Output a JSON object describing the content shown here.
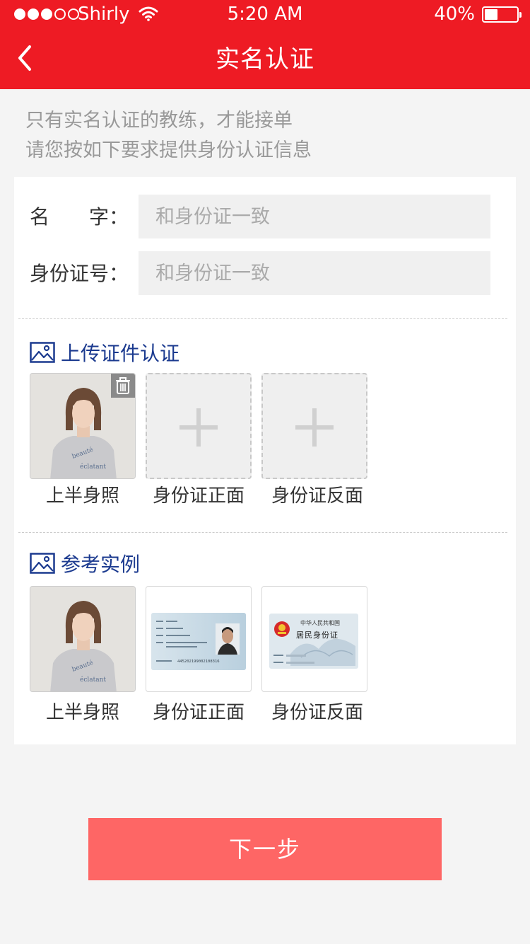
{
  "status_bar": {
    "carrier": "Shirly",
    "time": "5:20 AM",
    "battery": "40%",
    "signal_bars_filled": 3,
    "signal_bars_total": 5
  },
  "nav": {
    "title": "实名认证",
    "back_icon": "chevron-left-icon"
  },
  "notice": {
    "line1": "只有实名认证的教练，才能接单",
    "line2": "请您按如下要求提供身份认证信息"
  },
  "form": {
    "name_label": "名　　字：",
    "name_placeholder": "和身份证一致",
    "id_label": "身份证号：",
    "id_placeholder": "和身份证一致"
  },
  "upload": {
    "title": "上传证件认证",
    "icon": "image-icon",
    "items": [
      {
        "caption": "上半身照",
        "state": "uploaded"
      },
      {
        "caption": "身份证正面",
        "state": "empty"
      },
      {
        "caption": "身份证反面",
        "state": "empty"
      }
    ]
  },
  "reference": {
    "title": "参考实例",
    "icon": "image-icon",
    "items": [
      {
        "caption": "上半身照"
      },
      {
        "caption": "身份证正面"
      },
      {
        "caption": "身份证反面"
      }
    ],
    "id_front_number": "445202199002108316",
    "id_back_country": "中华人民共和国",
    "id_back_title": "居民身份证"
  },
  "actions": {
    "next_label": "下一步"
  },
  "colors": {
    "header_bg": "#ee1b24",
    "section_title": "#1b3a8f",
    "next_button_bg": "#fe6665",
    "page_bg": "#f4f4f4"
  }
}
